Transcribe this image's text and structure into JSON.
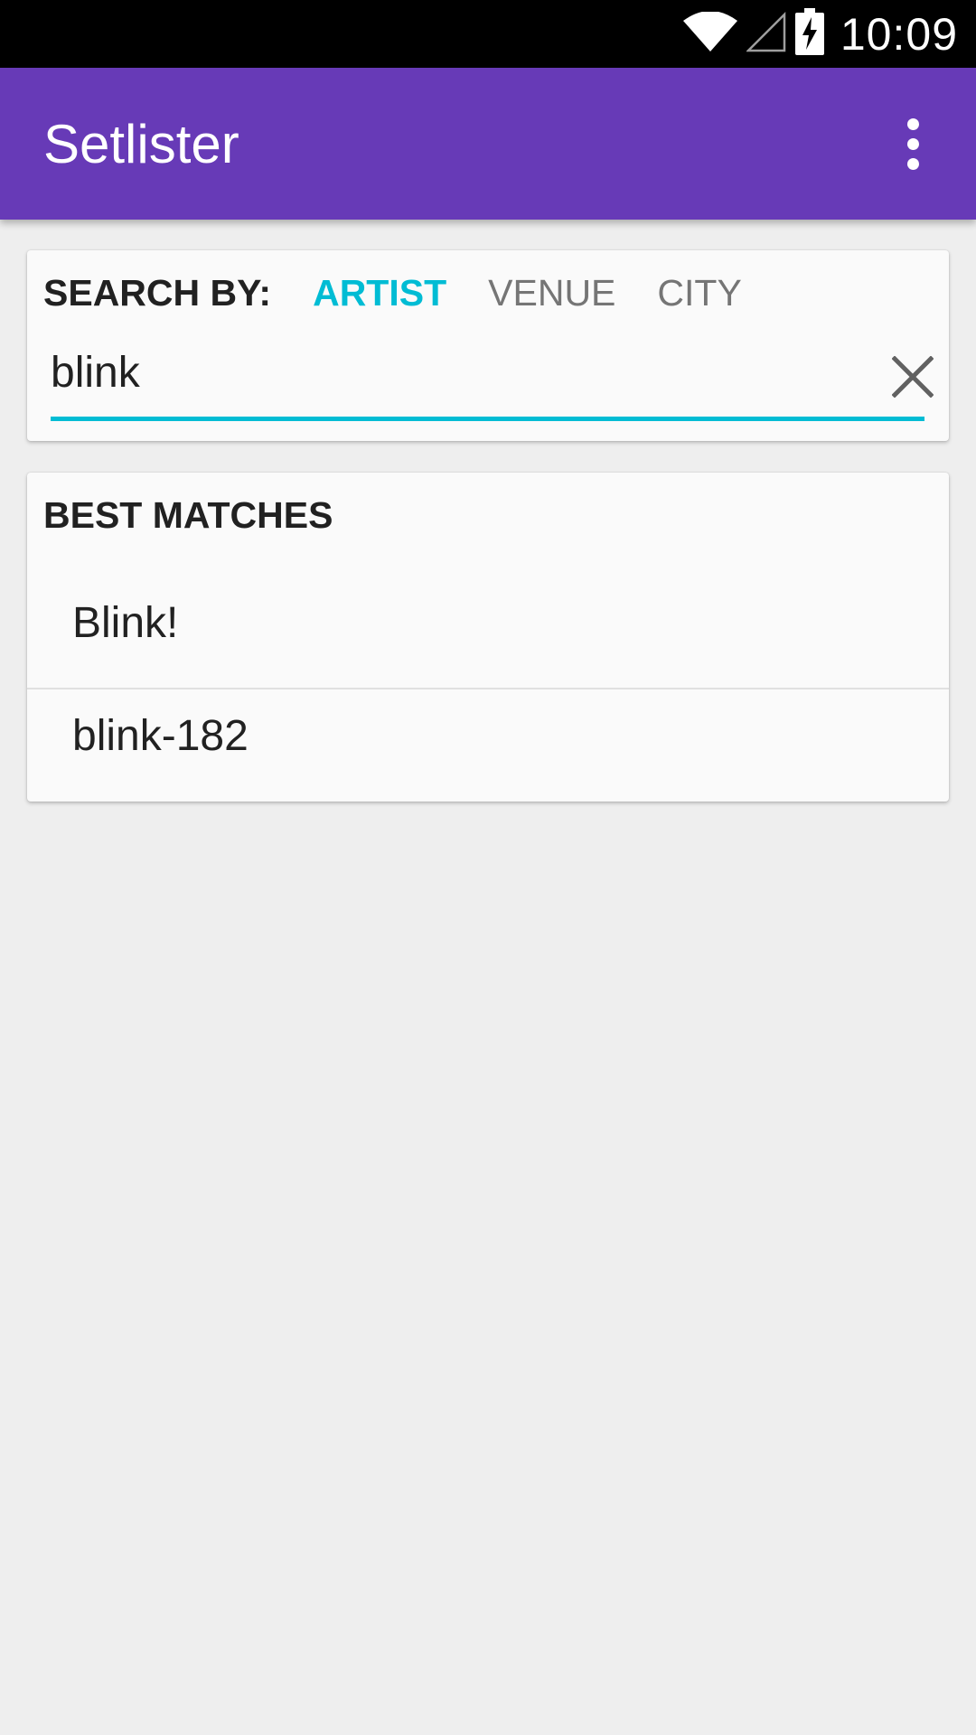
{
  "status_bar": {
    "time": "10:09",
    "icons": [
      "wifi-icon",
      "cell-signal-icon",
      "battery-charging-icon"
    ]
  },
  "app_bar": {
    "title": "Setlister",
    "menu_icon": "more-vert-icon",
    "color": "#673ab7"
  },
  "search": {
    "label": "SEARCH BY:",
    "tabs": [
      {
        "label": "ARTIST",
        "active": true
      },
      {
        "label": "VENUE",
        "active": false
      },
      {
        "label": "CITY",
        "active": false
      }
    ],
    "query": "blink",
    "clear_icon": "close-icon",
    "accent_color": "#00bcd4"
  },
  "results": {
    "header": "BEST MATCHES",
    "items": [
      {
        "label": "Blink!"
      },
      {
        "label": "blink-182"
      }
    ]
  }
}
